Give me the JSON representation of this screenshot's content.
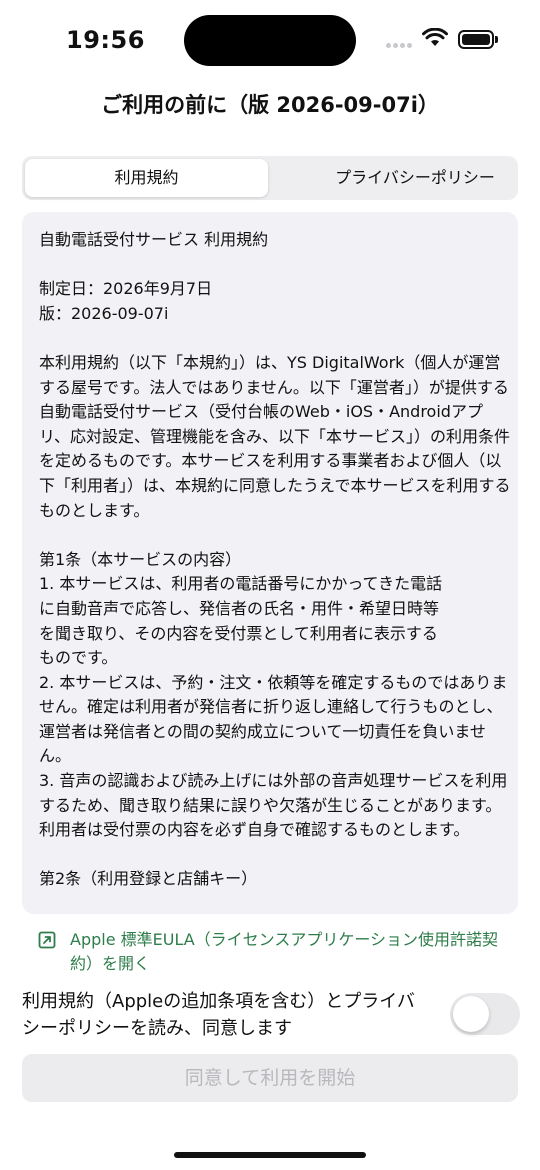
{
  "status_bar": {
    "time": "19:56",
    "icons": [
      "cellular-dots-icon",
      "wifi-icon",
      "battery-icon"
    ]
  },
  "header": {
    "title": "ご利用の前に（版 2026-09-07i）"
  },
  "tabs": [
    {
      "label": "利用規約",
      "selected": true
    },
    {
      "label": "プライバシーポリシー",
      "selected": false
    }
  ],
  "terms": {
    "text": "自動電話受付サービス 利用規約\n\n制定日：2026年9月7日\n版：2026-09-07i\n\n本利用規約（以下「本規約」）は、YS DigitalWork（個人が運営する屋号です。法人ではありません。以下「運営者」）が提供する自動電話受付サービス（受付台帳のWeb・iOS・Androidアプリ、応対設定、管理機能を含み、以下「本サービス」）の利用条件を定めるものです。本サービスを利用する事業者および個人（以下「利用者」）は、本規約に同意したうえで本サービスを利用するものとします。\n\n第1条（本サービスの内容）\n1. 本サービスは、利用者の電話番号にかかってきた電話\nに自動音声で応答し、発信者の氏名・用件・希望日時等\nを聞き取り、その内容を受付票として利用者に表示する\nものです。\n2. 本サービスは、予約・注文・依頼等を確定するものではありません。確定は利用者が発信者に折り返し連絡して行うものとし、運営者は発信者との間の契約成立について一切責任を負いません。\n3. 音声の認識および読み上げには外部の音声処理サービスを利用するため、聞き取り結果に誤りや欠落が生じることがあります。利用者は受付票の内容を必ず自身で確認するものとします。\n\n第2条（利用登録と店舗キー）"
  },
  "eula_link": {
    "label": "Apple 標準EULA（ライセンスアプリケーション使用許諾契約）を開く",
    "icon": "external-link-icon",
    "color": "#2e7d4a"
  },
  "agreement": {
    "label": "利用規約（Appleの追加条項を含む）とプライバシーポリシーを読み、同意します",
    "toggle_on": false
  },
  "start_button": {
    "label": "同意して利用を開始",
    "enabled": false
  }
}
